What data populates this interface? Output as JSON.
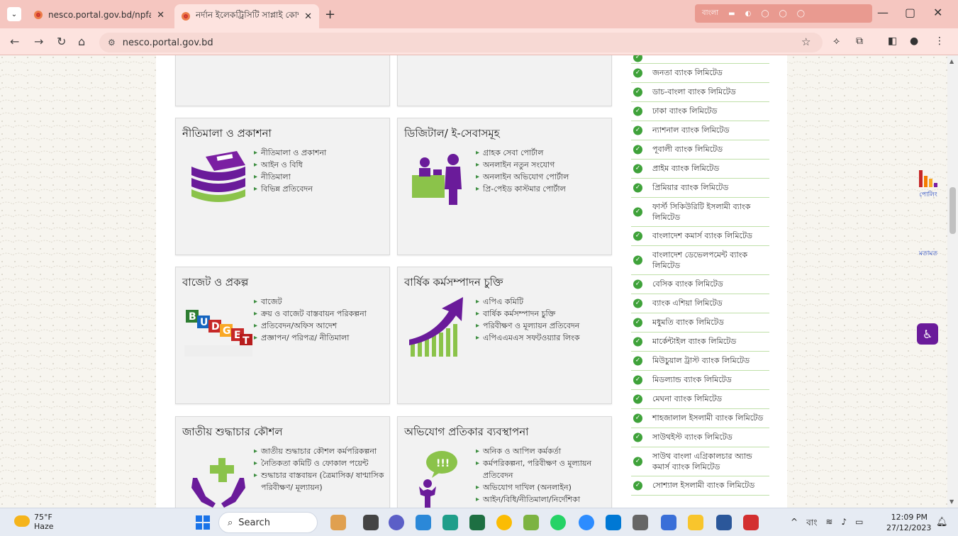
{
  "browser": {
    "tabs": [
      {
        "title": "nesco.portal.gov.bd/npfadmin/"
      },
      {
        "title": "নর্দান ইলেকট্রিসিটি সাপ্লাই কোম্প"
      }
    ],
    "url": "nesco.portal.gov.bd",
    "ext_strip_text": "বাংলা"
  },
  "cards": [
    {
      "title": "নীতিমালা ও প্রকাশনা",
      "items": [
        "নীতিমালা ও প্রকাশনা",
        "আইন ও বিধি",
        "নীতিমালা",
        "বিভিন্ন প্রতিবেদন"
      ]
    },
    {
      "title": "ডিজিটাল/ ই-সেবাসমূহ",
      "items": [
        "গ্রাহক সেবা পোর্টাল",
        "অনলাইন নতুন সংযোগ",
        "অনলাইন অভিযোগ পোর্টাল",
        "প্রি-পেইড কাস্টমার পোর্টাল"
      ]
    },
    {
      "title": "বাজেট ও প্রকল্প",
      "items": [
        "বাজেট",
        "ক্রয় ও বাজেট বাস্তবায়ন পরিকল্পনা",
        "প্রতিবেদন/অফিস আদেশ",
        "প্রজ্ঞাপন/ পরিপত্র/ নীতিমালা"
      ]
    },
    {
      "title": "বার্ষিক কর্মসম্পাদন চুক্তি",
      "items": [
        "এপিএ কমিটি",
        "বার্ষিক কর্মসম্পাদন চুক্তি",
        "পরিবীক্ষণ ও মূল্যায়ন প্রতিবেদন",
        "এপিএএমএস সফটওয়্যার লিংক"
      ]
    },
    {
      "title": "জাতীয় শুদ্ধাচার কৌশল",
      "items": [
        "জাতীয় শুদ্ধাচার কৌশল কর্মপরিকল্পনা",
        "নৈতিকতা কমিটি ও ফোকাল পয়েন্ট",
        "শুদ্ধাচার বাস্তবায়ন (ত্রৈমাসিক/ ষাণ্মাসিক পরিবীক্ষণ/ মূল্যায়ন)"
      ]
    },
    {
      "title": "অভিযোগ প্রতিকার ব্যবস্থাপনা",
      "items": [
        "অনিক ও আপিল কর্মকর্তা",
        "কর্মপরিকল্পনা, পরিবীক্ষণ ও মূল্যায়ন প্রতিবেদন",
        "অভিযোগ দাখিল (অনলাইন)",
        "আইন/বিধি/নীতিমালা/নির্দেশিকা"
      ]
    }
  ],
  "budget_blocks": [
    "B",
    "U",
    "D",
    "G",
    "E",
    "T"
  ],
  "banks": [
    "জনতা ব্যাংক লিমিটেড",
    "ডাচ-বাংলা ব্যাংক লিমিটেড",
    "ঢাকা ব্যাংক লিমিটেড",
    "ন্যাশনাল ব্যাংক লিমিটেড",
    "পূবালী ব্যাংক লিমিটেড",
    "প্রাইম ব্যাংক লিমিটেড",
    "প্রিমিয়ার ব্যাংক লিমিটেড",
    "ফার্স্ট সিকিউরিটি ইসলামী ব্যাংক লিমিটেড",
    "বাংলাদেশ কমার্স ব্যাংক লিমিটেড",
    "বাংলাদেশ ডেভেলপমেন্ট ব্যাংক লিমিটেড",
    "বেসিক ব্যাংক লিমিটেড",
    "ব্যাংক এশিয়া লিমিটেড",
    "মধুমতি ব্যাংক লিমিটেড",
    "মার্কেন্টাইল ব্যাংক লিমিটেড",
    "মিউচুয়াল ট্রাস্ট ব্যাংক লিমিটেড",
    "মিডল্যান্ড ব্যাংক লিমিটেড",
    "মেঘনা ব্যাংক লিমিটেড",
    "শাহজালাল ইসলামী ব্যাংক লিমিটেড",
    "সাউথইস্ট ব্যাংক লিমিটেড",
    "সাউথ বাংলা এগ্রিকালচার অ্যান্ড কমার্স ব্যাংক লিমিটেড",
    "সোশ্যাল ইসলামী ব্যাংক লিমিটেড"
  ],
  "side": {
    "poll_label": "পোলিং",
    "opinion_label": "মতামত"
  },
  "taskbar": {
    "temp": "75°F",
    "weather": "Haze",
    "search_label": "Search",
    "lang": "বাং",
    "time": "12:09 PM",
    "date": "27/12/2023"
  },
  "colors": {
    "tabbar": "#f5c6c0",
    "accent_green": "#3fa23a",
    "purple": "#6a1b9a"
  }
}
